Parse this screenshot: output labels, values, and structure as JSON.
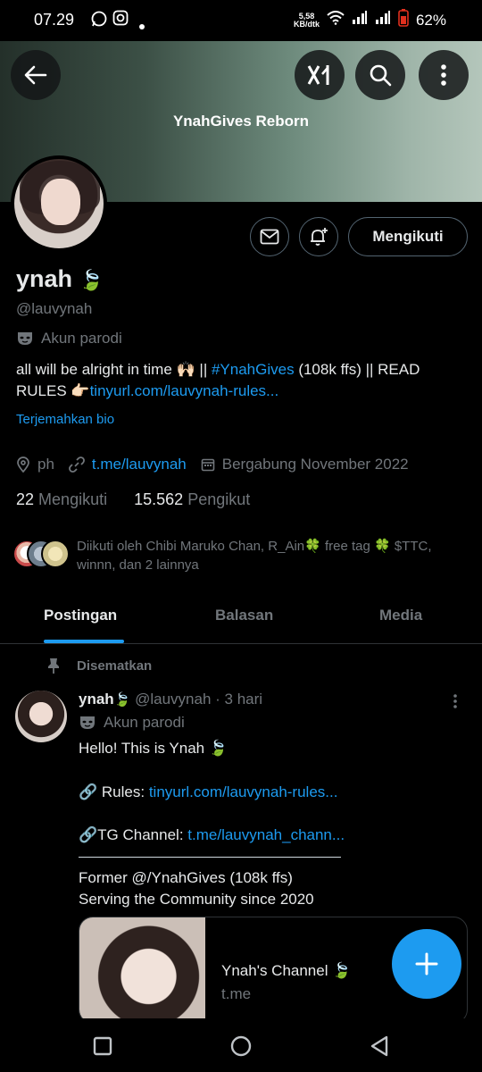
{
  "status_bar": {
    "time": "07.29",
    "net_speed_value": "5,58",
    "net_speed_unit": "KB/dtk",
    "battery": "62%"
  },
  "header": {
    "banner_title": "YnahGives Reborn",
    "follow_button": "Mengikuti"
  },
  "profile": {
    "name": "ynah",
    "handle": "@lauvynah",
    "parody_label": "Akun parodi",
    "bio_part1": "all will be alright in time 🙌🏻 || ",
    "bio_hashtag": "#YnahGives",
    "bio_part2": " (108k ffs) || READ RULES 👉🏻",
    "bio_link": "tinyurl.com/lauvynah-rules...",
    "translate_bio": "Terjemahkan bio",
    "location": "ph",
    "website": "t.me/lauvynah",
    "joined": "Bergabung November 2022",
    "following_count": "22",
    "following_label": "Mengikuti",
    "followers_count": "15.562",
    "followers_label": "Pengikut",
    "followed_by": "Diikuti oleh Chibi Maruko Chan, R_Ain🍀 free tag 🍀 $TTC, winnn, dan 2 lainnya"
  },
  "tabs": [
    {
      "label": "Postingan"
    },
    {
      "label": "Balasan"
    },
    {
      "label": "Media"
    }
  ],
  "pinned_post": {
    "pinned_label": "Disematkan",
    "author_name": "ynah",
    "author_handle": "@lauvynah",
    "time": "· 3 hari",
    "parody_label": "Akun parodi",
    "line1": "Hello! This is Ynah 🍃",
    "rules_prefix": "🔗 Rules: ",
    "rules_link": "tinyurl.com/lauvynah-rules...",
    "tg_prefix": "🔗TG Channel: ",
    "tg_link": "t.me/lauvynah_chann...",
    "line_former": "Former @/YnahGives (108k ffs)",
    "line_serving": "Serving the Community since 2020",
    "card_title": "Ynah's Channel 🍃",
    "card_url": "t.me"
  },
  "colors": {
    "accent": "#1d9bf0",
    "background": "#000000",
    "text": "#e7e9ea",
    "secondary": "#71767b"
  }
}
